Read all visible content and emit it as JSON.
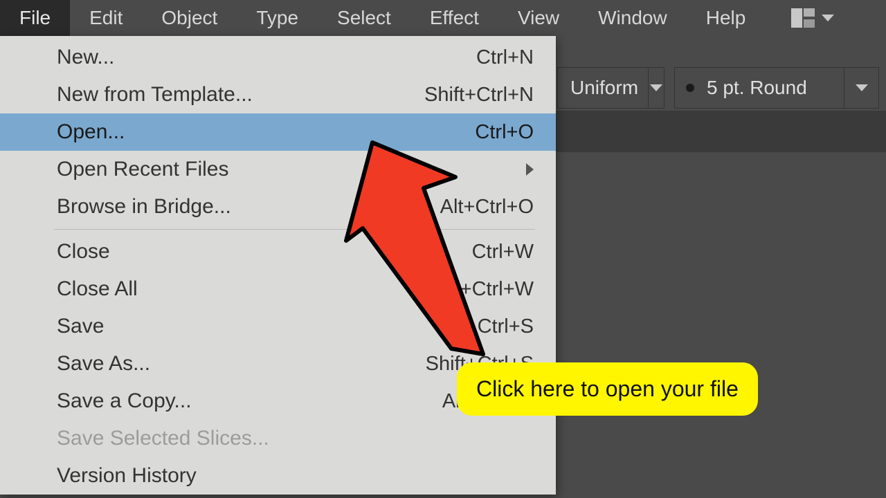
{
  "menubar": {
    "items": [
      "File",
      "Edit",
      "Object",
      "Type",
      "Select",
      "Effect",
      "View",
      "Window",
      "Help"
    ],
    "active_index": 0
  },
  "toolbar": {
    "stroke_profile": {
      "label": "Uniform"
    },
    "brush": {
      "label": "5 pt. Round"
    }
  },
  "file_menu": {
    "items": [
      {
        "label": "New...",
        "shortcut": "Ctrl+N",
        "highlighted": false
      },
      {
        "label": "New from Template...",
        "shortcut": "Shift+Ctrl+N",
        "highlighted": false
      },
      {
        "label": "Open...",
        "shortcut": "Ctrl+O",
        "highlighted": true
      },
      {
        "label": "Open Recent Files",
        "submenu": true,
        "highlighted": false
      },
      {
        "label": "Browse in Bridge...",
        "shortcut": "Alt+Ctrl+O",
        "highlighted": false
      },
      {
        "sep": true
      },
      {
        "label": "Close",
        "shortcut": "Ctrl+W",
        "highlighted": false
      },
      {
        "label": "Close All",
        "shortcut": "Alt+Ctrl+W",
        "highlighted": false
      },
      {
        "label": "Save",
        "shortcut": "Ctrl+S",
        "highlighted": false
      },
      {
        "label": "Save As...",
        "shortcut": "Shift+Ctrl+S",
        "highlighted": false
      },
      {
        "label": "Save a Copy...",
        "shortcut": "Alt+Ctrl+S",
        "highlighted": false
      },
      {
        "label": "Save Selected Slices...",
        "disabled": true,
        "highlighted": false
      },
      {
        "label": "Version History",
        "highlighted": false
      }
    ]
  },
  "annotation": {
    "callout": "Click here to open your file"
  }
}
